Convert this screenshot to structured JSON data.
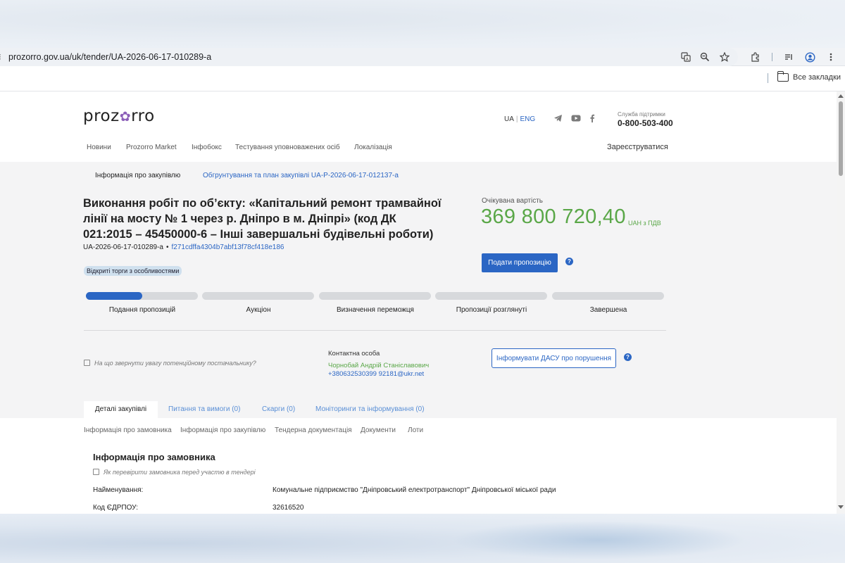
{
  "browser": {
    "url": "prozorro.gov.ua/uk/tender/UA-2026-06-17-010289-a",
    "bookmarks_label": "Все закладки",
    "icons": [
      "translate-icon",
      "zoom-icon",
      "star-icon",
      "extensions-icon",
      "reading-list-icon",
      "profile-icon",
      "menu-icon"
    ]
  },
  "header": {
    "logo_left": "proz",
    "logo_flower": "✿",
    "logo_right": "rro",
    "lang_ua": "UA",
    "lang_sep": "|",
    "lang_eng": "ENG",
    "support_label": "Служба підтримки",
    "support_phone": "0-800-503-400",
    "nav": [
      "Новини",
      "Prozorro Market",
      "Інфобокс",
      "Тестування уповноважених осіб",
      "Локалізація"
    ],
    "register": "Зареєструватися"
  },
  "tender": {
    "subtab_active": "Інформація про закупівлю",
    "subtab_link": "Обгрунтування та план закупівлі UA-P-2026-06-17-012137-a",
    "title": "Виконання робіт по об’єкту: «Капітальний ремонт трамвай­ної лінії на мосту № 1 через р. Дніпро в м. Дніпрі» (код ДК 021:2015 – 45450000-6 – Інші завершальні будівельні роботи)",
    "id": "UA-2026-06-17-010289-a",
    "dot": "•",
    "hash": "f271cdffa4304b7abf13f78cf418e186",
    "badge": "Відкриті торги з особливостями",
    "expected_label": "Очікувана вартість",
    "amount": "369 800 720,40",
    "amount_unit": "UAH з ПДВ",
    "bid_button": "Подати пропозицію",
    "help": "?",
    "progress_fraction": 0.5,
    "steps": [
      "Подання пропозицій",
      "Аукціон",
      "Визначення переможця",
      "Пропозиції розглянуті",
      "Завершена"
    ],
    "hint": "На що звернути увагу потенційному постачальнику?",
    "contact_label": "Контактна особа",
    "contact_name": "Чорнобай Андрій Станіславович",
    "contact_phone": "+380632530399 92181@ukr.net",
    "dasu_button": "Інформувати ДАСУ про порушення",
    "tabs": [
      "Деталі закупівлі",
      "Питання та вимоги (0)",
      "Скарги (0)",
      "Моніторинги та інформування (0)"
    ]
  },
  "details": {
    "anchors": [
      "Інформація про замовника",
      "Інформація про закупівлю",
      "Тендерна документація",
      "Документи",
      "Лоти"
    ],
    "section_title": "Інформація про замовника",
    "verify_hint": "Як перевірити замовника перед участю в тендері",
    "fields": [
      {
        "label": "Найменування:",
        "value": "Комунальне підприємство \"Дніпровський електротранспорт\" Дніпровської міської ради"
      },
      {
        "label": "Код ЄДРПОУ:",
        "value": "32616520"
      }
    ]
  },
  "colors": {
    "accent": "#2b66c4",
    "amount_green": "#5aa748",
    "logo_flower": "#8c5fb8"
  }
}
